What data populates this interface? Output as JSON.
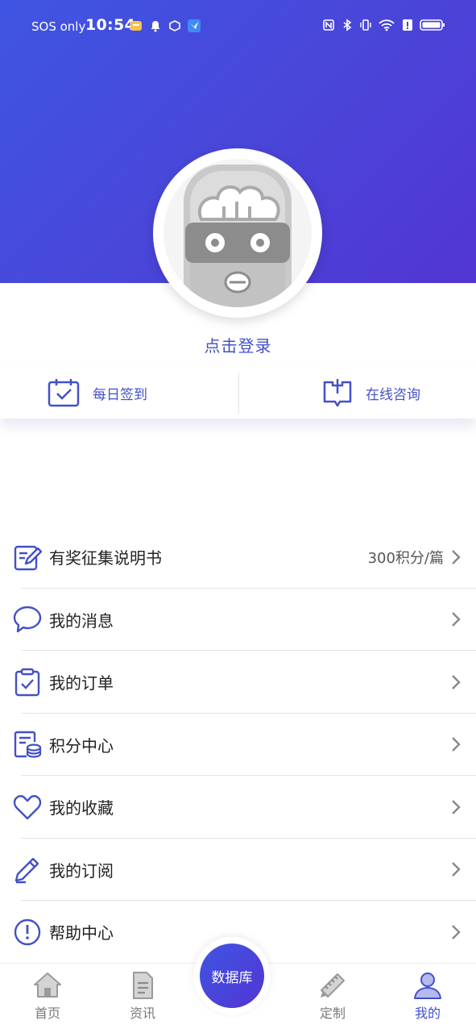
{
  "status_bar": {
    "carrier": "SOS only",
    "time": "10:54"
  },
  "profile": {
    "login_text": "点击登录"
  },
  "quick_actions": [
    {
      "label": "每日签到",
      "icon": "calendar-check-icon"
    },
    {
      "label": "在线咨询",
      "icon": "consult-book-icon"
    }
  ],
  "menu": [
    {
      "label": "有奖征集说明书",
      "extra": "300积分/篇",
      "icon": "edit-note-icon"
    },
    {
      "label": "我的消息",
      "extra": "",
      "icon": "message-bubble-icon"
    },
    {
      "label": "我的订单",
      "extra": "",
      "icon": "clipboard-check-icon"
    },
    {
      "label": "积分中心",
      "extra": "",
      "icon": "points-coin-icon"
    },
    {
      "label": "我的收藏",
      "extra": "",
      "icon": "heart-icon"
    },
    {
      "label": "我的订阅",
      "extra": "",
      "icon": "pencil-icon"
    },
    {
      "label": "帮助中心",
      "extra": "",
      "icon": "help-exclamation-icon"
    }
  ],
  "tabbar": {
    "home": "首页",
    "news": "资讯",
    "database": "数据库",
    "custom": "定制",
    "mine": "我的"
  },
  "colors": {
    "brand": "#4350c8",
    "header_start": "#3f55e2",
    "header_end": "#5235d3"
  }
}
